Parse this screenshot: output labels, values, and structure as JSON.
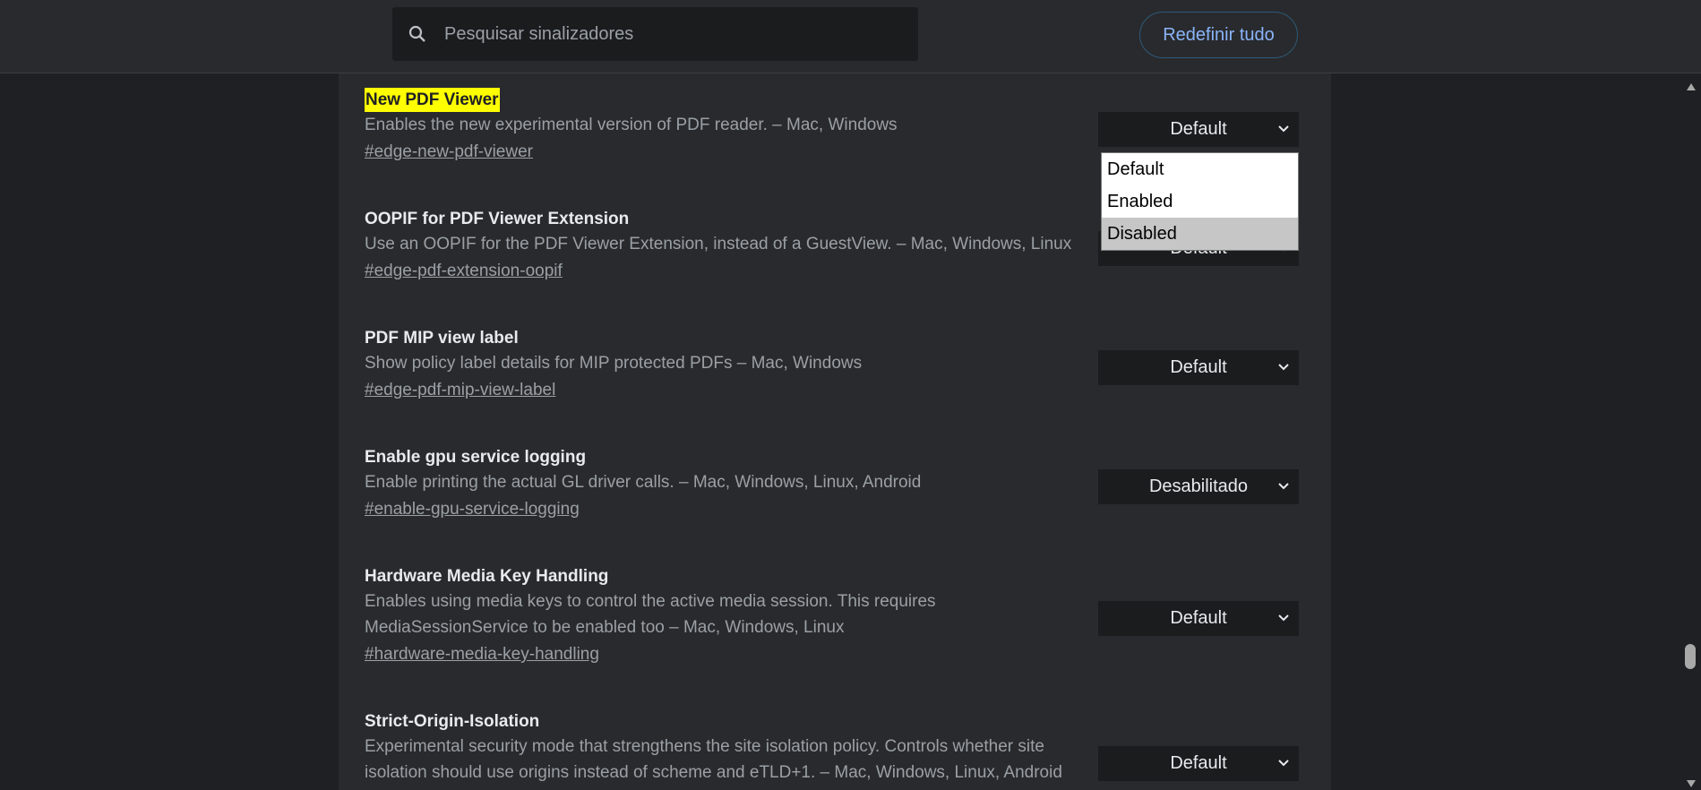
{
  "header": {
    "search_placeholder": "Pesquisar sinalizadores",
    "reset_label": "Redefinir tudo"
  },
  "flags": [
    {
      "title": "New PDF Viewer",
      "description": "Enables the new experimental version of PDF reader. – Mac, Windows",
      "link": "#edge-new-pdf-viewer",
      "value": "Default",
      "highlighted": true
    },
    {
      "title": "OOPIF for PDF Viewer Extension",
      "description": "Use an OOPIF for the PDF Viewer Extension, instead of a GuestView. – Mac, Windows, Linux",
      "link": "#edge-pdf-extension-oopif",
      "value": "Default"
    },
    {
      "title": "PDF MIP view label",
      "description": "Show policy label details for MIP protected PDFs – Mac, Windows",
      "link": "#edge-pdf-mip-view-label",
      "value": "Default"
    },
    {
      "title": "Enable gpu service logging",
      "description": "Enable printing the actual GL driver calls. – Mac, Windows, Linux, Android",
      "link": "#enable-gpu-service-logging",
      "value": "Desabilitado"
    },
    {
      "title": "Hardware Media Key Handling",
      "description": "Enables using media keys to control the active media session. This requires MediaSessionService to be enabled too – Mac, Windows, Linux",
      "link": "#hardware-media-key-handling",
      "value": "Default"
    },
    {
      "title": "Strict-Origin-Isolation",
      "description": "Experimental security mode that strengthens the site isolation policy. Controls whether site isolation should use origins instead of scheme and eTLD+1. – Mac, Windows, Linux, Android",
      "link": "",
      "value": "Default"
    }
  ],
  "dropdown": {
    "options": [
      "Default",
      "Enabled",
      "Disabled"
    ],
    "highlighted_option": "Disabled"
  },
  "colors": {
    "highlight": "#ffff00",
    "accent": "#8ab4f8"
  }
}
